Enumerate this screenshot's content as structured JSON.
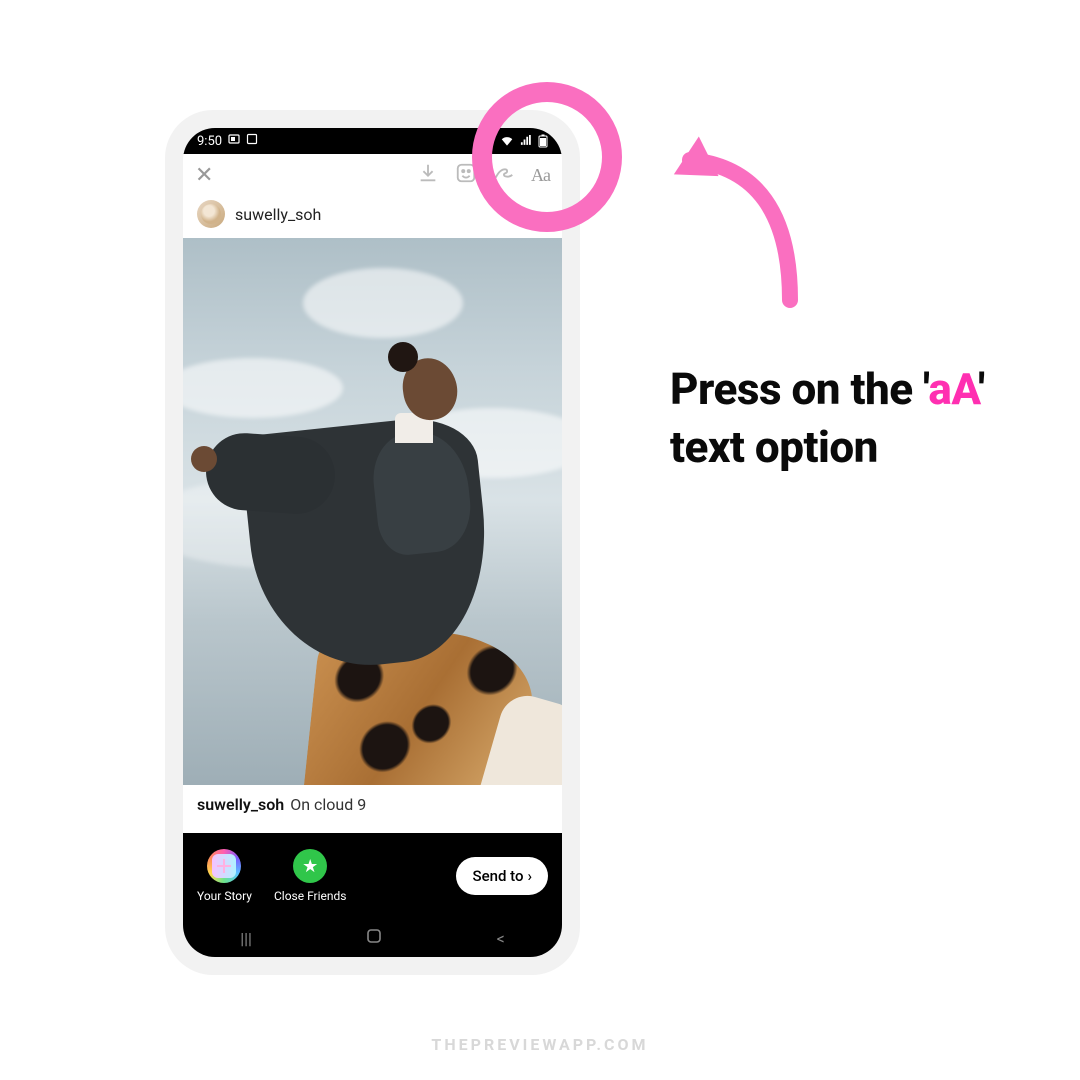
{
  "statusbar": {
    "time": "9:50"
  },
  "toolbar": {
    "text_tool_label": "Aa"
  },
  "user": {
    "name": "suwelly_soh"
  },
  "caption": {
    "user": "suwelly_soh",
    "text": "On cloud 9"
  },
  "share": {
    "your_story": "Your Story",
    "close_friends": "Close Friends",
    "send_to": "Send to"
  },
  "instruction": {
    "pre": "Press on the '",
    "highlight": "aA",
    "post": "' text option"
  },
  "watermark": "THEPREVIEWAPP.COM",
  "colors": {
    "pink": "#fa6fc0",
    "magenta": "#ff2fb1",
    "green": "#30c64a"
  }
}
